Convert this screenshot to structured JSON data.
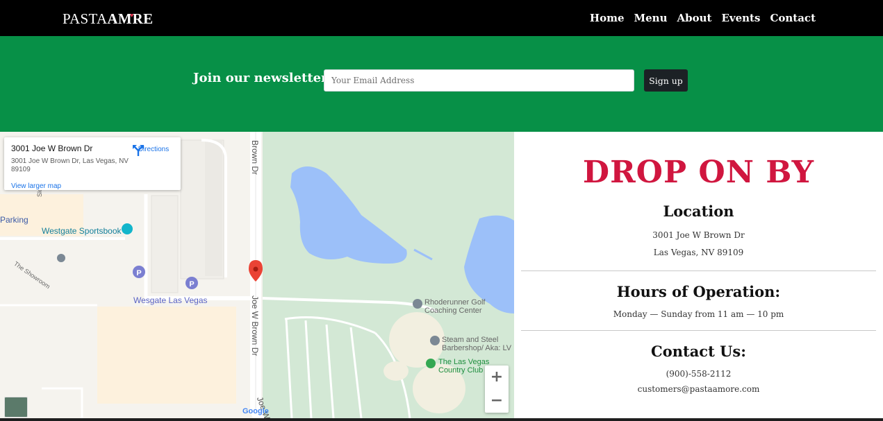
{
  "header": {
    "logo": {
      "part1": "PASTA",
      "part2": "AM",
      "part3": "RE"
    },
    "nav": [
      "Home",
      "Menu",
      "About",
      "Events",
      "Contact"
    ]
  },
  "newsletter": {
    "label": "Join our newsletter!",
    "email_placeholder": "Your Email Address",
    "button_label": "Sign up"
  },
  "map": {
    "infocard": {
      "title": "3001 Joe W Brown Dr",
      "address": "3001 Joe W Brown Dr, Las Vegas, NV 89109",
      "directions_label": "Directions",
      "larger_map_link": "View larger map"
    },
    "labels": {
      "road_top": "Brown Dr",
      "road_main": "Joe W Brown Dr",
      "road_bottom": "Joe W",
      "parking": "Parking",
      "sportsbook": "Westgate Sportsbook",
      "showroom": "The Showroom",
      "slots": "Slots",
      "westgate": "Wesgate Las Vegas",
      "golf_coaching_1": "Rhoderunner Golf",
      "golf_coaching_2": "Coaching Center",
      "barbershop_1": "Steam and Steel",
      "barbershop_2": "Barbershop/ Aka: LV",
      "country_club_1": "The Las Vegas",
      "country_club_2": "Country Club",
      "google": "Google"
    },
    "zoom_in": "+",
    "zoom_out": "−",
    "colors": {
      "water": "#9cc0f9",
      "park": "#d3e8d5",
      "land": "#f5f3ee",
      "building": "#fdf1dd",
      "pin": "#ea4335"
    }
  },
  "info": {
    "heading": "DROP ON BY",
    "location": {
      "title": "Location",
      "line1": "3001 Joe W Brown Dr",
      "line2": "Las Vegas, NV 89109"
    },
    "hours": {
      "title": "Hours of Operation:",
      "text": "Monday — Sunday from 11 am — 10 pm"
    },
    "contact": {
      "title": "Contact Us:",
      "phone": "(900)-558-2112",
      "email": "customers@pastaamore.com"
    }
  },
  "colors": {
    "header_bg": "#000000",
    "newsletter_bg": "#079047",
    "heading_red": "#d0163f",
    "button_dark": "#1c2125"
  }
}
